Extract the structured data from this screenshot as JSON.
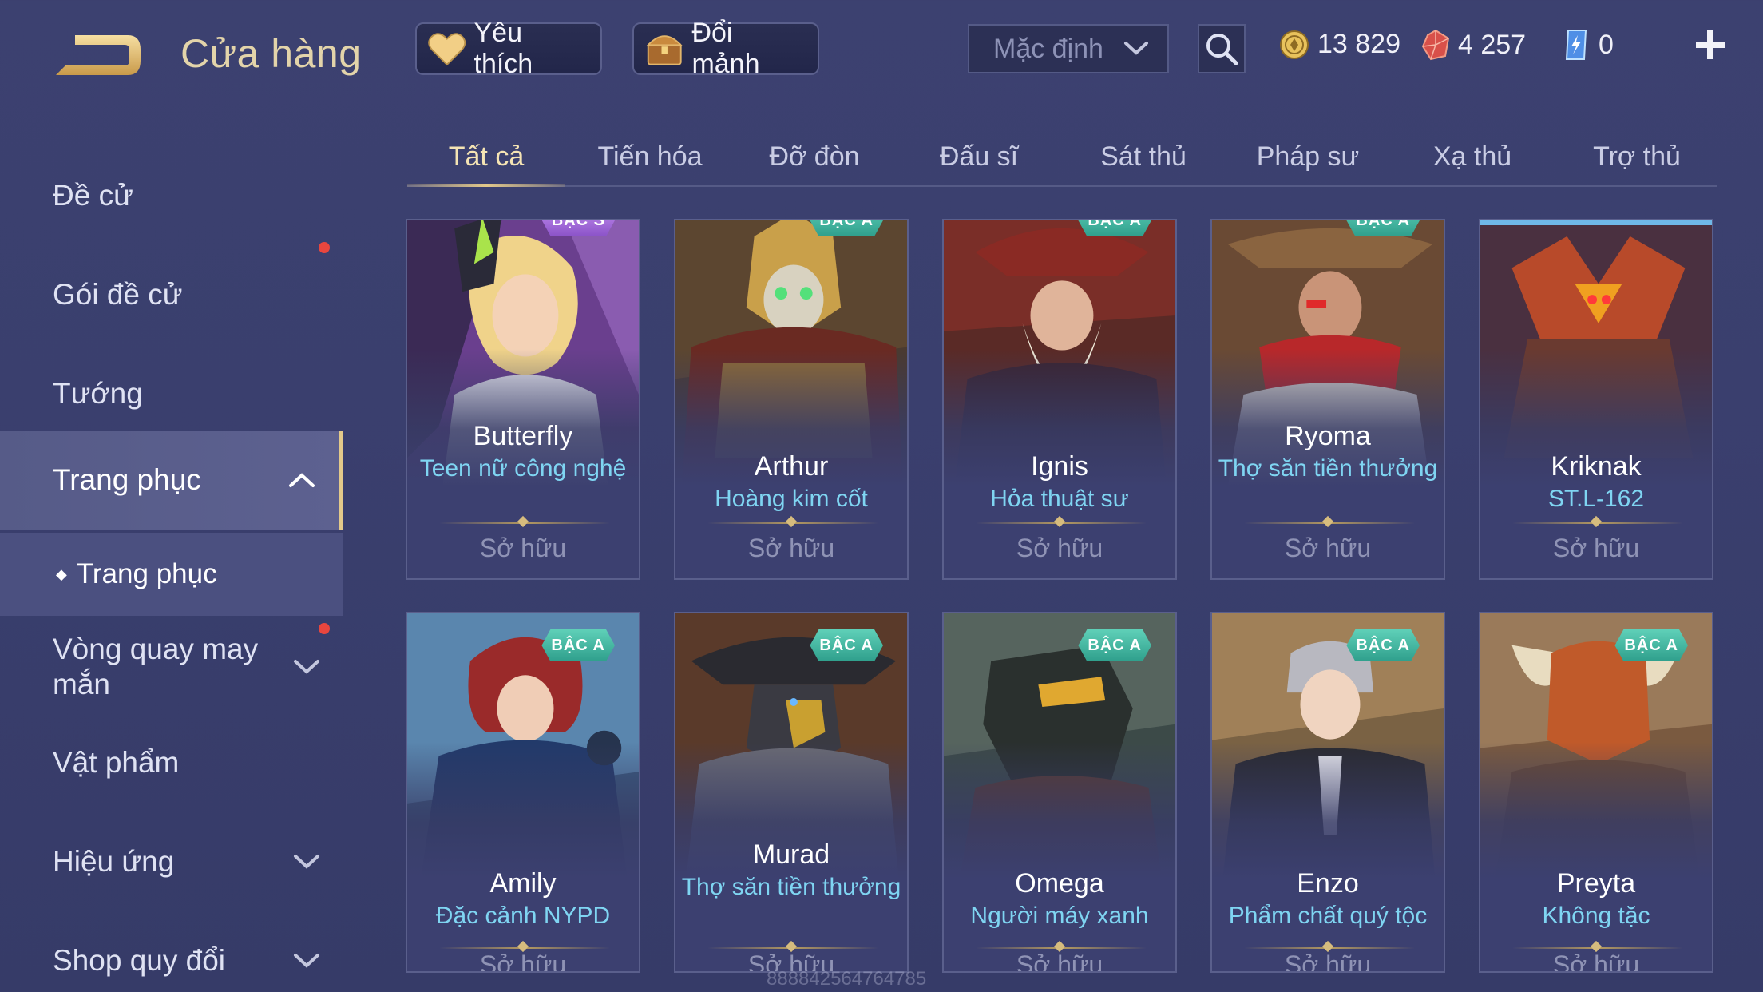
{
  "header": {
    "title": "Cửa hàng",
    "favorite_label": "Yêu thích",
    "exchange_label": "Đổi mảnh",
    "sort": {
      "selected": "Mặc định"
    },
    "currencies": {
      "gold": "13 829",
      "ruby": "4 257",
      "voucher": "0"
    }
  },
  "sidebar": {
    "items": [
      {
        "label": "Đề cử"
      },
      {
        "label": "Gói đề cử"
      },
      {
        "label": "Tướng"
      },
      {
        "label": "Trang phục"
      },
      {
        "label": "Trang phục"
      },
      {
        "label": "Vòng quay may mắn"
      },
      {
        "label": "Vật phẩm"
      },
      {
        "label": "Hiệu ứng"
      },
      {
        "label": "Shop quy đổi"
      }
    ]
  },
  "tabs": [
    {
      "label": "Tất cả"
    },
    {
      "label": "Tiến hóa"
    },
    {
      "label": "Đỡ đòn"
    },
    {
      "label": "Đấu sĩ"
    },
    {
      "label": "Sát thủ"
    },
    {
      "label": "Pháp sư"
    },
    {
      "label": "Xạ thủ"
    },
    {
      "label": "Trợ thủ"
    }
  ],
  "skins": [
    {
      "hero": "Butterfly",
      "skin": "Teen nữ công nghệ",
      "badge": "BẬC S",
      "status": "Sở hữu"
    },
    {
      "hero": "Arthur",
      "skin": "Hoàng kim cốt",
      "badge": "BẬC A",
      "status": "Sở hữu"
    },
    {
      "hero": "Ignis",
      "skin": "Hỏa thuật sư",
      "badge": "BẬC A",
      "status": "Sở hữu"
    },
    {
      "hero": "Ryoma",
      "skin": "Thợ săn tiền thưởng",
      "badge": "BẬC A",
      "status": "Sở hữu"
    },
    {
      "hero": "Kriknak",
      "skin": "ST.L-162",
      "badge": "",
      "status": "Sở hữu"
    },
    {
      "hero": "Amily",
      "skin": "Đặc cảnh NYPD",
      "badge": "BẬC A",
      "status": "Sở hữu"
    },
    {
      "hero": "Murad",
      "skin": "Thợ săn tiền thưởng",
      "badge": "BẬC A",
      "status": "Sở hữu"
    },
    {
      "hero": "Omega",
      "skin": "Người máy xanh",
      "badge": "BẬC A",
      "status": "Sở hữu"
    },
    {
      "hero": "Enzo",
      "skin": "Phẩm chất quý tộc",
      "badge": "BẬC A",
      "status": "Sở hữu"
    },
    {
      "hero": "Preyta",
      "skin": "Không tặc",
      "badge": "BẬC A",
      "status": "Sở hữu"
    }
  ],
  "watermark": "888842564764785",
  "colors": {
    "background": "#3a3f6e",
    "accent_gold": "#e3c98a",
    "skin_name": "#7fd5f2",
    "badge_teal": "#3fb5a0",
    "badge_purple": "#a86ee0",
    "notification": "#e8463e"
  }
}
